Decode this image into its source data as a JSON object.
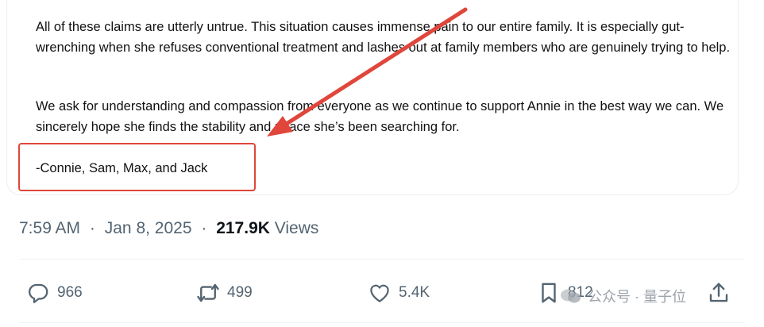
{
  "tweet": {
    "paragraphs": [
      "All of these claims are utterly untrue. This situation causes immense pain to our entire family. It is especially gut-wrenching when she refuses conventional treatment and lashes out at family members who are genuinely trying to help.",
      "We ask for understanding and compassion from everyone as we continue to support Annie in the best way we can. We sincerely hope she finds the stability and peace she’s been searching for."
    ],
    "signature": "-Connie, Sam, Max, and Jack"
  },
  "meta": {
    "time": "7:59 AM",
    "separator": "·",
    "date": "Jan 8, 2025",
    "views_count": "217.9K",
    "views_label": "Views"
  },
  "actions": {
    "replies": "966",
    "reposts": "499",
    "likes": "5.4K",
    "bookmarks": "812"
  },
  "watermark": {
    "text": "公众号 · 量子位"
  },
  "colors": {
    "annotation_red": "#e0463b",
    "meta_gray": "#536471",
    "text": "#0f1419"
  },
  "icons": [
    "reply-icon",
    "retweet-icon",
    "heart-icon",
    "bookmark-icon",
    "share-icon",
    "arrow-annotation"
  ]
}
